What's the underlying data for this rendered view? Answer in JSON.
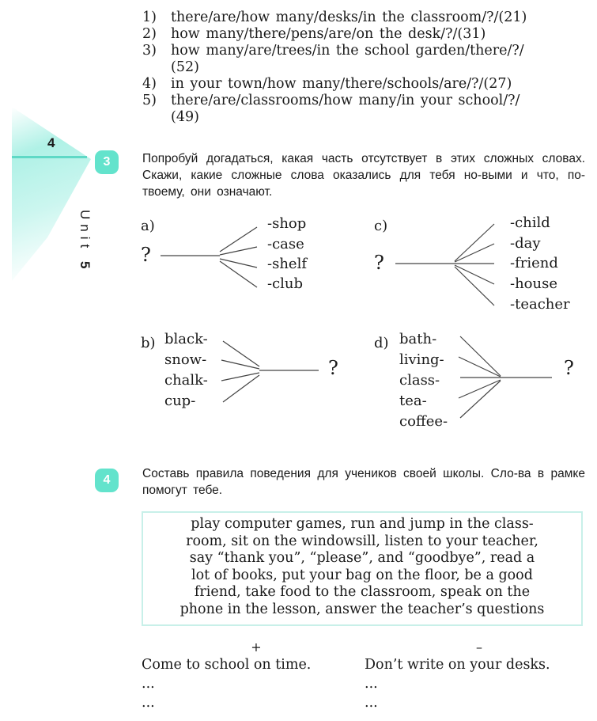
{
  "sidebar": {
    "page_number": "4",
    "unit_label": "Unit",
    "unit_number": "5",
    "accent_color": "#5fd9c6"
  },
  "exercise_list": [
    {
      "num": "1)",
      "text": "there/are/how many/desks/in the classroom/?/(21)"
    },
    {
      "num": "2)",
      "text": "how many/there/pens/are/on the desk/?/(31)"
    },
    {
      "num": "3)",
      "text": "how many/are/trees/in the school garden/there/?/"
    },
    {
      "num": "",
      "text": "(52)"
    },
    {
      "num": "4)",
      "text": "in your town/how many/there/schools/are/?/(27)"
    },
    {
      "num": "5)",
      "text": "there/are/classrooms/how many/in your school/?/"
    },
    {
      "num": "",
      "text": "(49)"
    }
  ],
  "task3": {
    "badge": "3",
    "instruction": "Попробуй догадаться, какая часть отсутствует в этих сложных словах. Скажи, какие сложные слова оказались для тебя но-выми и что, по-твоему, они означают.",
    "diagrams": {
      "a": {
        "label": "a)",
        "question": "?",
        "words": [
          "-shop",
          "-case",
          "-shelf",
          "-club"
        ]
      },
      "b": {
        "label": "b)",
        "question": "?",
        "words": [
          "black-",
          "snow-",
          "chalk-",
          "cup-"
        ]
      },
      "c": {
        "label": "c)",
        "question": "?",
        "words": [
          "-child",
          "-day",
          "-friend",
          "-house",
          "-teacher"
        ]
      },
      "d": {
        "label": "d)",
        "question": "?",
        "words": [
          "bath-",
          "living-",
          "class-",
          "tea-",
          "coffee-"
        ]
      }
    }
  },
  "task4": {
    "badge": "4",
    "instruction": "Составь правила поведения для учеников своей школы. Сло-ва в рамке помогут тебе.",
    "word_box_lines": [
      "play computer games, run and jump in the class-",
      "room, sit on the windowsill, listen to your teacher,",
      "say “thank you”, “please”, and “goodbye”, read a",
      "lot of books, put your bag on the floor, be a good",
      "friend, take food to the classroom, speak on the",
      "phone in the lesson, answer the teacher’s questions"
    ],
    "rules": {
      "plus": {
        "sign": "+",
        "lines": [
          "Come to school on time.",
          "...",
          "..."
        ]
      },
      "minus": {
        "sign": "–",
        "lines": [
          "Don’t write on your desks.",
          "...",
          "..."
        ]
      }
    }
  }
}
